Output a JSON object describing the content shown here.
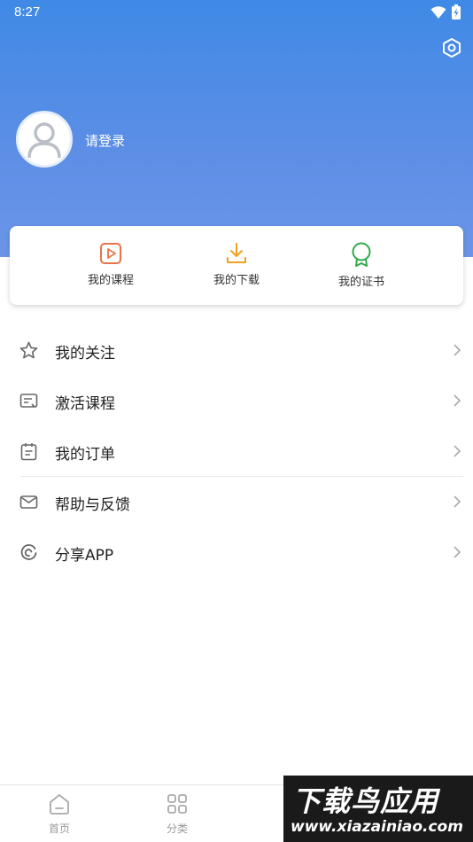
{
  "status_bar": {
    "time": "8:27"
  },
  "profile": {
    "login_prompt": "请登录"
  },
  "quick_actions": [
    {
      "label": "我的课程",
      "icon": "play-square-icon",
      "color": "#e8744a"
    },
    {
      "label": "我的下载",
      "icon": "download-icon",
      "color": "#f0a020"
    },
    {
      "label": "我的证书",
      "icon": "medal-icon",
      "color": "#2faa4a"
    }
  ],
  "menu": [
    {
      "label": "我的关注",
      "icon": "star-icon"
    },
    {
      "label": "激活课程",
      "icon": "activate-icon"
    },
    {
      "label": "我的订单",
      "icon": "order-icon"
    },
    {
      "label": "帮助与反馈",
      "icon": "mail-icon"
    },
    {
      "label": "分享APP",
      "icon": "share-icon"
    }
  ],
  "tabbar": [
    {
      "label": "首页",
      "icon": "home-icon"
    },
    {
      "label": "分类",
      "icon": "grid-icon"
    }
  ],
  "watermark": {
    "title": "下载鸟应用",
    "url": "www.xiazainiao.com"
  },
  "colors": {
    "accent": "#4a8be6",
    "text": "#222222",
    "muted": "#999999"
  }
}
